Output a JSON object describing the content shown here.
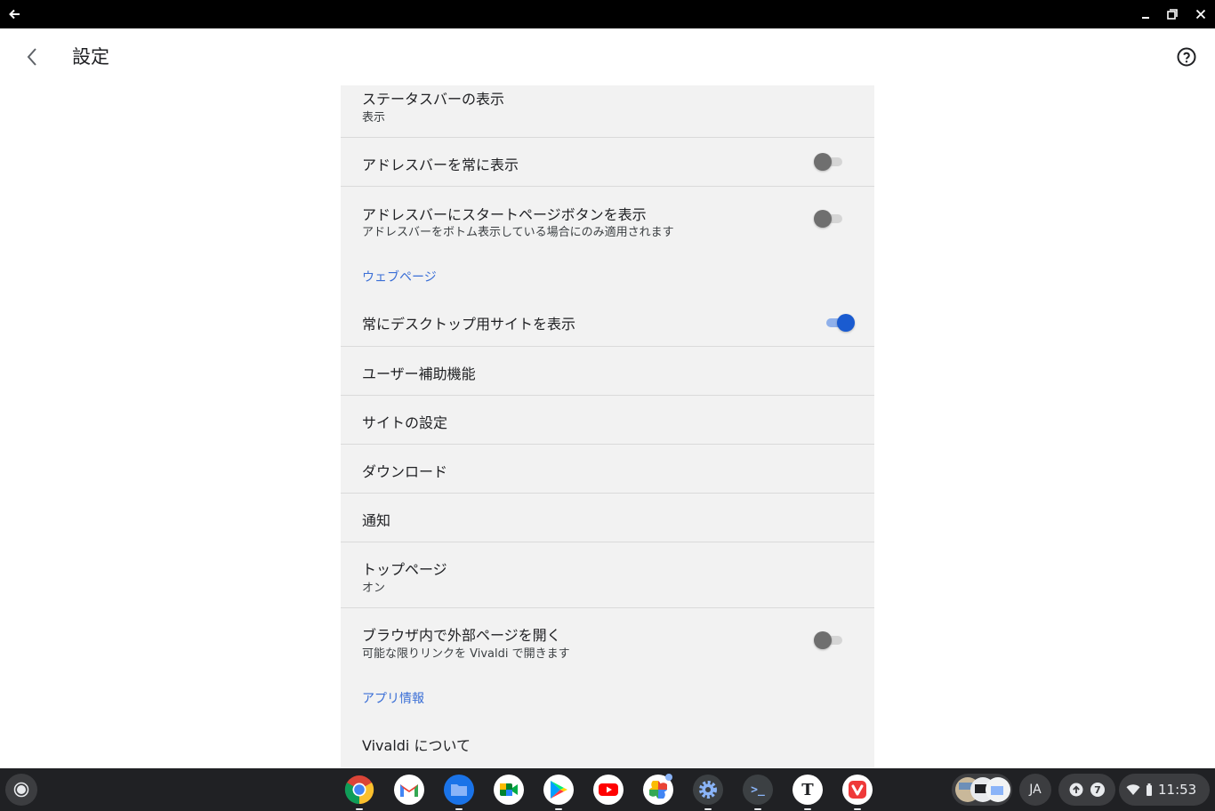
{
  "window": {
    "back_icon": "arrow-left-icon",
    "minimize_icon": "minimize-icon",
    "restore_icon": "restore-icon",
    "close_icon": "close-icon"
  },
  "appbar": {
    "title": "設定",
    "back_icon": "chevron-left-icon",
    "help_icon": "help-circle-icon"
  },
  "settings": {
    "status_bar": {
      "label": "ステータスバーの表示",
      "sub": "表示"
    },
    "address_bar_always": {
      "label": "アドレスバーを常に表示",
      "checked": false
    },
    "start_page_button": {
      "label": "アドレスバーにスタートページボタンを表示",
      "sub": "アドレスバーをボトム表示している場合にのみ適用されます",
      "checked": false
    },
    "section_webpage": "ウェブページ",
    "desktop_site": {
      "label": "常にデスクトップ用サイトを表示",
      "checked": true
    },
    "accessibility": {
      "label": "ユーザー補助機能"
    },
    "site_settings": {
      "label": "サイトの設定"
    },
    "downloads": {
      "label": "ダウンロード"
    },
    "notifications": {
      "label": "通知"
    },
    "top_page": {
      "label": "トップページ",
      "sub": "オン"
    },
    "open_external": {
      "label": "ブラウザ内で外部ページを開く",
      "sub": "可能な限りリンクを Vivaldi で開きます",
      "checked": false
    },
    "section_app_info": "アプリ情報",
    "about": {
      "label": "Vivaldi について"
    }
  },
  "colors": {
    "accent": "#1a5bd0",
    "section": "#3b6fd6",
    "panel": "#f2f2f2",
    "shelf": "#202124"
  },
  "shelf": {
    "launcher_icon": "launcher-circle-icon",
    "apps": [
      {
        "name": "chrome-icon"
      },
      {
        "name": "gmail-icon"
      },
      {
        "name": "files-icon"
      },
      {
        "name": "meet-icon"
      },
      {
        "name": "play-store-icon"
      },
      {
        "name": "youtube-icon"
      },
      {
        "name": "photos-icon"
      },
      {
        "name": "settings-app-icon"
      },
      {
        "name": "terminal-icon",
        "glyph": ">_"
      },
      {
        "name": "text-app-icon",
        "glyph": "T"
      },
      {
        "name": "vivaldi-icon"
      }
    ],
    "ime": "JA",
    "notification_count": "7",
    "time": "11:53"
  }
}
